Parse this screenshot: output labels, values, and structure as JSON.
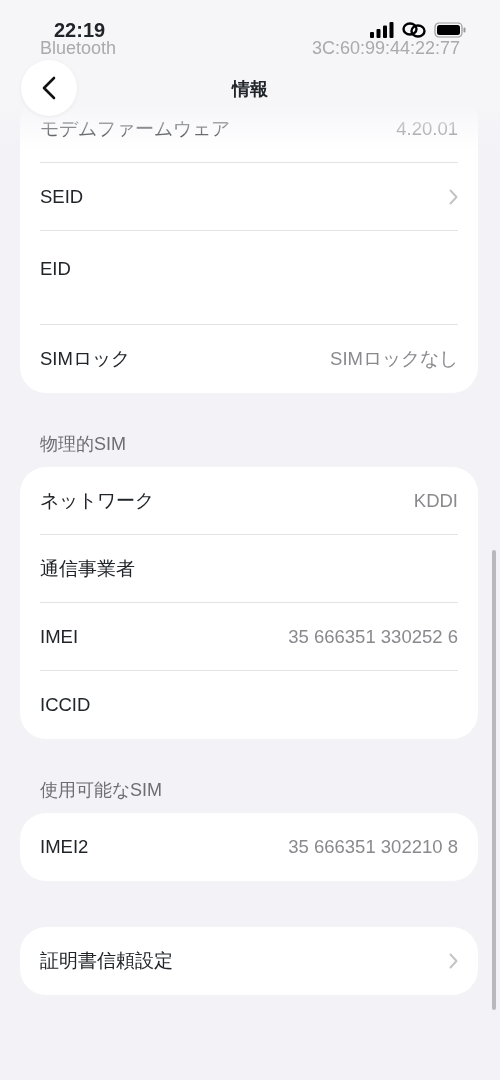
{
  "status_bar": {
    "time": "22:19"
  },
  "nav": {
    "title": "情報"
  },
  "faded_row": {
    "label": "Bluetooth",
    "value": "3C:60:99:44:22:77"
  },
  "sections": [
    {
      "rows": [
        {
          "kind": "value",
          "label": "モデムファームウェア",
          "value": "4.20.01"
        },
        {
          "kind": "chevron",
          "label": "SEID"
        },
        {
          "kind": "tall",
          "label": "EID"
        },
        {
          "kind": "value",
          "label": "SIMロック",
          "value": "SIMロックなし"
        }
      ]
    },
    {
      "header": "物理的SIM",
      "rows": [
        {
          "kind": "value",
          "label": "ネットワーク",
          "value": "KDDI"
        },
        {
          "kind": "value",
          "label": "通信事業者"
        },
        {
          "kind": "value",
          "label": "IMEI",
          "value": "35 666351 330252 6"
        },
        {
          "kind": "value",
          "label": "ICCID"
        }
      ]
    },
    {
      "header": "使用可能なSIM",
      "rows": [
        {
          "kind": "value",
          "label": "IMEI2",
          "value": "35 666351 302210 8"
        }
      ]
    },
    {
      "rows": [
        {
          "kind": "chevron",
          "label": "証明書信頼設定"
        }
      ]
    }
  ]
}
